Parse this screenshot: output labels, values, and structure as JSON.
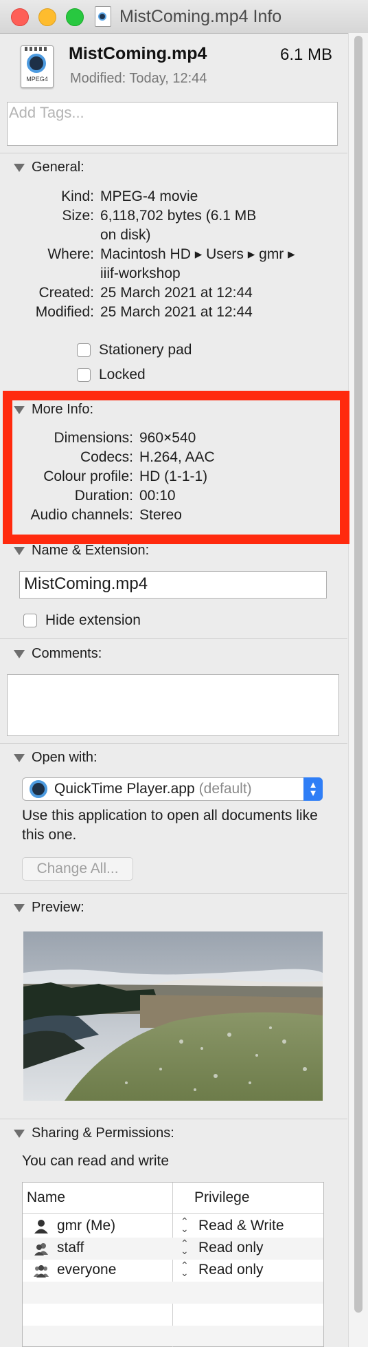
{
  "window": {
    "title": "MistComing.mp4 Info"
  },
  "header": {
    "file_name": "MistComing.mp4",
    "file_size": "6.1 MB",
    "modified_label": "Modified:",
    "modified_value": "Today, 12:44",
    "icon_label": "MPEG4"
  },
  "tags": {
    "placeholder": "Add Tags..."
  },
  "general": {
    "title": "General:",
    "rows": [
      {
        "key": "Kind:",
        "value": "MPEG-4 movie"
      },
      {
        "key": "Size:",
        "value": "6,118,702 bytes (6.1 MB",
        "value2": "on disk)"
      },
      {
        "key": "Where:",
        "value": "Macintosh HD ▸ Users ▸ gmr ▸",
        "value2": "iiif-workshop"
      },
      {
        "key": "Created:",
        "value": "25 March 2021 at 12:44"
      },
      {
        "key": "Modified:",
        "value": "25 March 2021 at 12:44"
      }
    ],
    "stationery_label": "Stationery pad",
    "locked_label": "Locked"
  },
  "more_info": {
    "title": "More Info:",
    "rows": [
      {
        "key": "Dimensions:",
        "value": "960×540"
      },
      {
        "key": "Codecs:",
        "value": "H.264, AAC"
      },
      {
        "key": "Colour profile:",
        "value": "HD (1-1-1)"
      },
      {
        "key": "Duration:",
        "value": "00:10"
      },
      {
        "key": "Audio channels:",
        "value": "Stereo"
      }
    ],
    "highlight_color": "#ff2a0e"
  },
  "name_extension": {
    "title": "Name & Extension:",
    "value": "MistComing.mp4",
    "hide_extension_label": "Hide extension"
  },
  "comments": {
    "title": "Comments:"
  },
  "open_with": {
    "title": "Open with:",
    "app": "QuickTime Player.app",
    "app_suffix": "(default)",
    "description": "Use this application to open all documents like this one.",
    "change_all": "Change All..."
  },
  "preview": {
    "title": "Preview:"
  },
  "sharing": {
    "title": "Sharing & Permissions:",
    "status": "You can read and write",
    "col_name": "Name",
    "col_privilege": "Privilege",
    "rows": [
      {
        "name": "gmr (Me)",
        "privilege": "Read & Write",
        "icon": "user-icon"
      },
      {
        "name": "staff",
        "privilege": "Read only",
        "icon": "group-icon"
      },
      {
        "name": "everyone",
        "privilege": "Read only",
        "icon": "everyone-icon"
      }
    ]
  },
  "colors": {
    "accent": "#2f7ef6",
    "window_bg": "#ececec"
  }
}
